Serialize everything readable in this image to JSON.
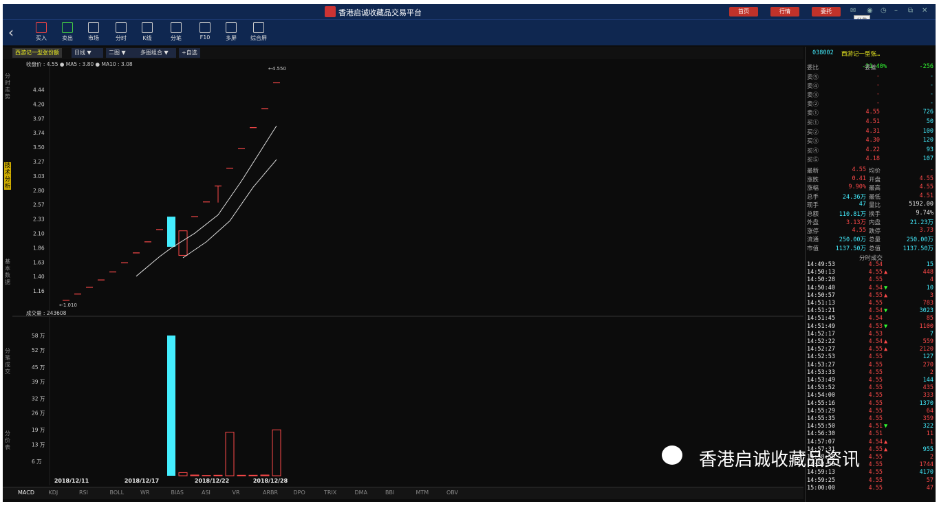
{
  "window": {
    "title": "香港启诚收藏品交易平台",
    "buttons": [
      "首页",
      "行情",
      "委托"
    ],
    "tooltip": "公告"
  },
  "toolbar": [
    {
      "label": "买入",
      "icon": "buy-icon"
    },
    {
      "label": "卖出",
      "icon": "sell-icon"
    },
    {
      "label": "市场",
      "icon": "market-icon"
    },
    {
      "label": "分时",
      "icon": "timeshare-icon"
    },
    {
      "label": "K线",
      "icon": "kline-icon"
    },
    {
      "label": "分笔",
      "icon": "tick-icon"
    },
    {
      "label": "F10",
      "icon": "f10-icon"
    },
    {
      "label": "多屏",
      "icon": "multiscreen-icon"
    },
    {
      "label": "综合屏",
      "icon": "dashboard-icon"
    }
  ],
  "tabs": {
    "name": "西游记一型张份额",
    "period": "日线",
    "layout": "二图",
    "combo": "多图组合",
    "add": "+自选"
  },
  "left_labels": [
    "分时走势",
    "技术分析",
    "基本数据",
    "分笔成交",
    "分价表"
  ],
  "chart": {
    "price_legend": "收盘价 : 4.55  ● MA5 : 3.80  ● MA10 : 3.08",
    "vol_legend": "成交量 : 243608",
    "price_ticks": [
      "4.44",
      "4.20",
      "3.97",
      "3.74",
      "3.50",
      "3.27",
      "3.03",
      "2.80",
      "2.57",
      "2.33",
      "2.10",
      "1.86",
      "1.63",
      "1.40",
      "1.16"
    ],
    "vol_ticks": [
      "58 万",
      "52 万",
      "45 万",
      "39 万",
      "32 万",
      "26 万",
      "19 万",
      "13 万",
      "6 万"
    ],
    "dates": [
      "2018/12/11",
      "2018/12/17",
      "2018/12/22",
      "2018/12/28"
    ],
    "high_label": "4.550",
    "low_label": "1.010"
  },
  "chart_data": {
    "type": "candlestick",
    "ylim": [
      1.01,
      4.55
    ],
    "candles": [
      {
        "o": 1.01,
        "c": 1.01
      },
      {
        "o": 1.11,
        "c": 1.11
      },
      {
        "o": 1.22,
        "c": 1.22
      },
      {
        "o": 1.34,
        "c": 1.34
      },
      {
        "o": 1.47,
        "c": 1.47
      },
      {
        "o": 1.62,
        "c": 1.62
      },
      {
        "o": 1.78,
        "c": 1.78
      },
      {
        "o": 1.96,
        "c": 1.96
      },
      {
        "o": 2.16,
        "c": 2.16
      },
      {
        "o": 2.37,
        "c": 1.88,
        "down": true
      },
      {
        "o": 2.14,
        "c": 1.74
      },
      {
        "o": 2.37,
        "c": 2.37
      },
      {
        "o": 2.61,
        "c": 2.61
      },
      {
        "o": 2.87,
        "c": 2.6,
        "wick": true
      },
      {
        "o": 3.16,
        "c": 3.16
      },
      {
        "o": 3.48,
        "c": 3.48
      },
      {
        "o": 3.82,
        "c": 3.82
      },
      {
        "o": 4.13,
        "c": 4.13
      },
      {
        "o": 4.55,
        "c": 4.55
      }
    ],
    "volume_wan": [
      0,
      0,
      0,
      0,
      0,
      0,
      0,
      0,
      0,
      58,
      1.3,
      0.3,
      0.1,
      0.2,
      18,
      0.2,
      0.2,
      0.3,
      19
    ]
  },
  "quote": {
    "code": "038002",
    "name": "西游记一型张…",
    "header": {
      "l1": "委比",
      "v1": "-21.40%",
      "l2": "委差",
      "v2": "-256"
    },
    "sell": [
      [
        "卖⑤",
        "-",
        "-"
      ],
      [
        "卖④",
        "-",
        "-"
      ],
      [
        "卖③",
        "-",
        "-"
      ],
      [
        "卖②",
        "-",
        "-"
      ],
      [
        "卖①",
        "4.55",
        "726"
      ]
    ],
    "buy": [
      [
        "买①",
        "4.51",
        "50"
      ],
      [
        "买②",
        "4.31",
        "100"
      ],
      [
        "买③",
        "4.30",
        "120"
      ],
      [
        "买④",
        "4.22",
        "93"
      ],
      [
        "买⑤",
        "4.18",
        "107"
      ]
    ],
    "stats": [
      [
        "最新",
        "4.55",
        "均价",
        "-"
      ],
      [
        "涨跌",
        "0.41",
        "开盘",
        "4.55"
      ],
      [
        "涨幅",
        "9.90%",
        "最高",
        "4.55"
      ],
      [
        "总手",
        "24.36万",
        "最低",
        "4.51"
      ],
      [
        "现手",
        "47",
        "量比",
        "5192.00"
      ],
      [
        "总额",
        "110.81万",
        "换手",
        "9.74%"
      ],
      [
        "外盘",
        "3.13万",
        "内盘",
        "21.23万"
      ],
      [
        "涨停",
        "4.55",
        "跌停",
        "3.73"
      ],
      [
        "流通",
        "250.00万",
        "总量",
        "250.00万"
      ],
      [
        "市值",
        "1137.50万",
        "总值",
        "1137.50万"
      ]
    ],
    "ticks_title": "分时成交",
    "ticks": [
      [
        "14:49:53",
        "4.54",
        "",
        "15"
      ],
      [
        "14:50:13",
        "4.55",
        "▲",
        "448"
      ],
      [
        "14:50:28",
        "4.55",
        "",
        "4"
      ],
      [
        "14:50:40",
        "4.54",
        "▼",
        "10"
      ],
      [
        "14:50:57",
        "4.55",
        "▲",
        "3"
      ],
      [
        "14:51:13",
        "4.55",
        "",
        "783"
      ],
      [
        "14:51:21",
        "4.54",
        "▼",
        "3023"
      ],
      [
        "14:51:45",
        "4.54",
        "",
        "85"
      ],
      [
        "14:51:49",
        "4.53",
        "▼",
        "1100"
      ],
      [
        "14:52:17",
        "4.53",
        "",
        "7"
      ],
      [
        "14:52:22",
        "4.54",
        "▲",
        "559"
      ],
      [
        "14:52:27",
        "4.55",
        "▲",
        "2120"
      ],
      [
        "14:52:53",
        "4.55",
        "",
        "127"
      ],
      [
        "14:53:27",
        "4.55",
        "",
        "270"
      ],
      [
        "14:53:33",
        "4.55",
        "",
        "2"
      ],
      [
        "14:53:49",
        "4.55",
        "",
        "144"
      ],
      [
        "14:53:52",
        "4.55",
        "",
        "435"
      ],
      [
        "14:54:00",
        "4.55",
        "",
        "333"
      ],
      [
        "14:55:16",
        "4.55",
        "",
        "1370"
      ],
      [
        "14:55:29",
        "4.55",
        "",
        "64"
      ],
      [
        "14:55:35",
        "4.55",
        "",
        "359"
      ],
      [
        "14:55:50",
        "4.51",
        "▼",
        "322"
      ],
      [
        "14:56:30",
        "4.51",
        "",
        "11"
      ],
      [
        "14:57:07",
        "4.54",
        "▲",
        "1"
      ],
      [
        "14:57:31",
        "4.55",
        "▲",
        "955"
      ],
      [
        "14:58:50",
        "4.55",
        "",
        "2"
      ],
      [
        "14:58:58",
        "4.55",
        "",
        "1744"
      ],
      [
        "14:59:13",
        "4.55",
        "",
        "4170"
      ],
      [
        "14:59:25",
        "4.55",
        "",
        "57"
      ],
      [
        "15:00:00",
        "4.55",
        "",
        "47"
      ]
    ]
  },
  "bottom_tabs": [
    "MACD",
    "KDJ",
    "RSI",
    "BOLL",
    "WR",
    "BIAS",
    "ASI",
    "VR",
    "ARBR",
    "DPO",
    "TRIX",
    "DMA",
    "BBI",
    "MTM",
    "OBV"
  ],
  "watermark": "香港启诚收藏品资讯",
  "colors": {
    "up": "#ff4a4a",
    "cyan": "#4ef",
    "bg": "#0c0c0c",
    "titlebar": "#0f2750"
  }
}
